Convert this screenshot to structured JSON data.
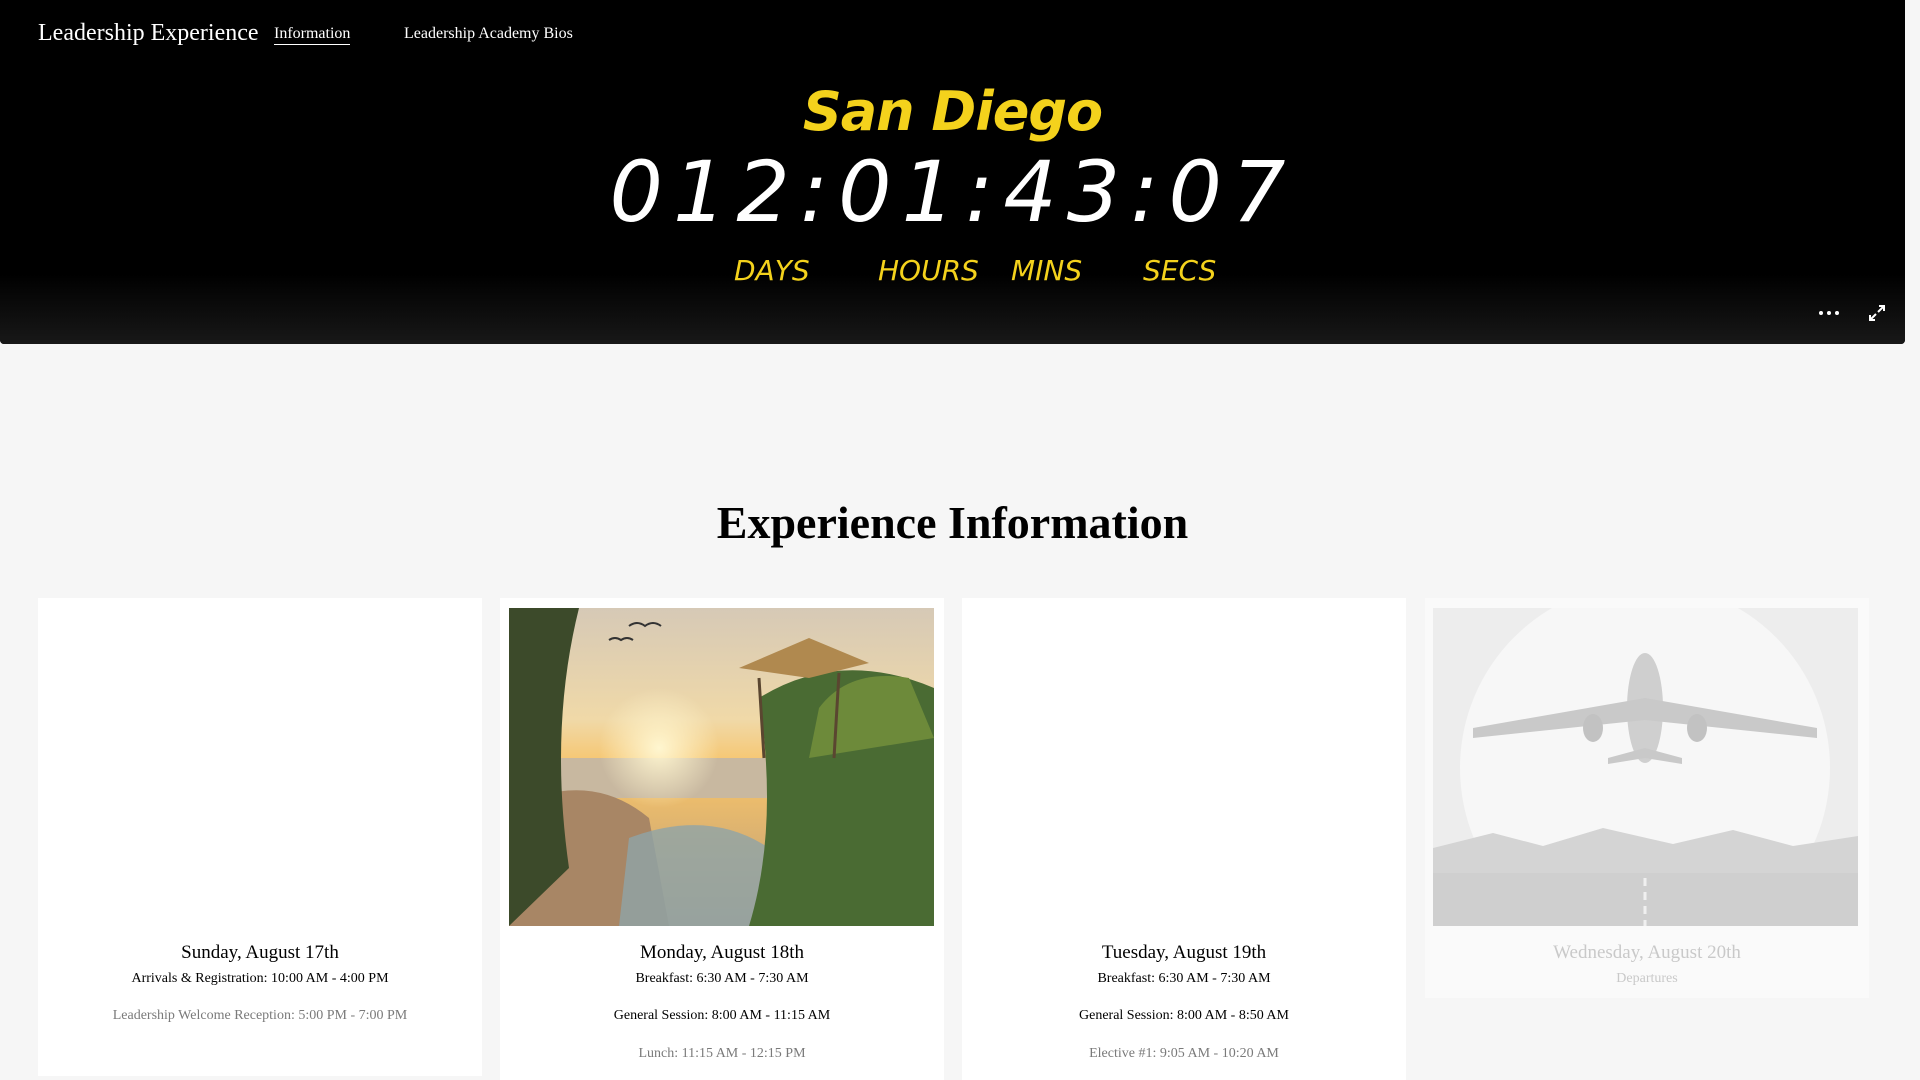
{
  "nav": {
    "brand": "Leadership Experience",
    "links": [
      {
        "label": "Information",
        "active": true
      },
      {
        "label": "Leadership Academy Bios",
        "active": false
      }
    ]
  },
  "countdown": {
    "city": "San Diego",
    "timer": "012:01:43:07",
    "units": [
      "DAYS",
      "HOURS",
      "MINS",
      "SECS"
    ],
    "accent_color": "#f4d21c",
    "controls": [
      "more-icon",
      "fullscreen-icon"
    ]
  },
  "section": {
    "title": "Experience Information"
  },
  "cards": [
    {
      "day": "Sunday, August 17th",
      "lines": [
        "Arrivals & Registration: 10:00 AM - 4:00 PM",
        "Leadership Welcome Reception: 5:00 PM - 7:00 PM"
      ],
      "image": "none"
    },
    {
      "day": "Monday, August 18th",
      "lines": [
        "Breakfast: 6:30 AM - 7:30 AM",
        "General Session: 8:00 AM - 11:15 AM",
        "Lunch: 11:15 AM - 12:15 PM"
      ],
      "image": "beach-sunset-hut"
    },
    {
      "day": "Tuesday, August 19th",
      "lines": [
        "Breakfast: 6:30 AM - 7:30 AM",
        "General Session: 8:00 AM - 8:50 AM",
        "Elective #1: 9:05 AM - 10:20 AM"
      ],
      "image": "none"
    },
    {
      "day": "Wednesday, August 20th",
      "lines": [
        "Departures"
      ],
      "image": "airplane-takeoff"
    }
  ]
}
